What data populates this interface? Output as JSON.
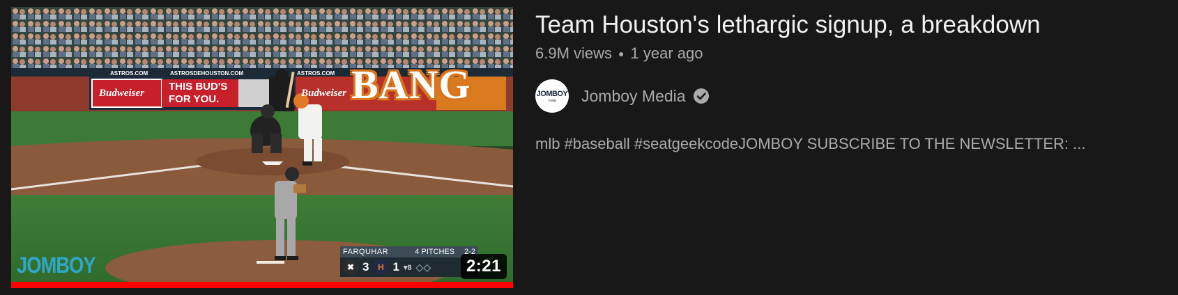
{
  "video": {
    "title": "Team Houston's lethargic signup, a breakdown",
    "views": "6.9M views",
    "age": "1 year ago",
    "duration": "2:21",
    "watch_progress": 1.0,
    "description": "mlb #baseball #seatgeekcodeJOMBOY SUBSCRIBE TO THE NEWSLETTER: ...",
    "channel": {
      "name": "Jomboy Media",
      "avatar_text": "JOMBOY",
      "avatar_subtext": "media",
      "verified_icon": "verified-check-icon"
    }
  },
  "thumbnail": {
    "overlay_text": "BANG",
    "watermark": "JOMBOY",
    "ads": {
      "astros_com_1": "ASTROS.COM",
      "astros_com_2": "ASTROSDEHOUSTON.COM",
      "astros_com_3": "ASTROS.COM",
      "budweiser_1": "Budweiser",
      "budweiser_2": "Budweiser",
      "bud_slogan_1": "THIS BUD'S",
      "bud_slogan_2": "FOR YOU."
    },
    "scorebug": {
      "pitcher": "FARQUHAR",
      "pitches": "4 PITCHES",
      "count": "2-2",
      "away_score": "3",
      "home_score": "1",
      "inning": "8"
    }
  },
  "colors": {
    "background": "#181818",
    "title": "#f1f1f1",
    "secondary": "#aaaaaa",
    "progress": "#ff0000"
  }
}
